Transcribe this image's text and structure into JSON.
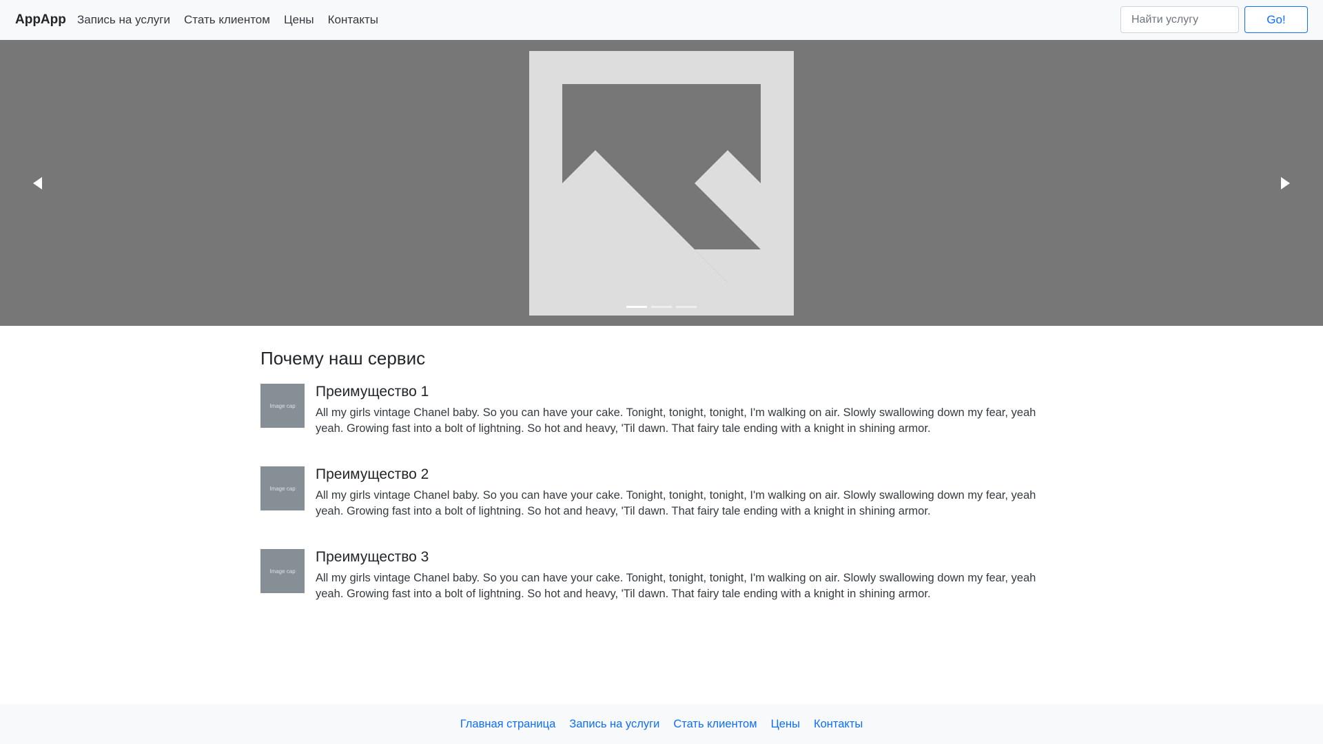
{
  "navbar": {
    "brand": "AppApp",
    "links": [
      "Запись на услуги",
      "Стать клиентом",
      "Цены",
      "Контакты"
    ],
    "search": {
      "placeholder": "Найти услугу",
      "value": ""
    },
    "go_label": "Go!"
  },
  "carousel": {
    "slides_count": 3,
    "active_index": 0,
    "icons": {
      "prev": "triangle-left-icon",
      "next": "triangle-right-icon",
      "image": "image-placeholder-icon"
    },
    "colors": {
      "background": "#777777",
      "image_fill": "#dddddd"
    }
  },
  "main": {
    "section_title": "Почему наш сервис",
    "features": [
      {
        "image_label": "Image cap",
        "title": "Преимущество 1",
        "text": "All my girls vintage Chanel baby. So you can have your cake. Tonight, tonight, tonight, I'm walking on air. Slowly swallowing down my fear, yeah yeah. Growing fast into a bolt of lightning. So hot and heavy, 'Til dawn. That fairy tale ending with a knight in shining armor."
      },
      {
        "image_label": "Image cap",
        "title": "Преимущество 2",
        "text": "All my girls vintage Chanel baby. So you can have your cake. Tonight, tonight, tonight, I'm walking on air. Slowly swallowing down my fear, yeah yeah. Growing fast into a bolt of lightning. So hot and heavy, 'Til dawn. That fairy tale ending with a knight in shining armor."
      },
      {
        "image_label": "Image cap",
        "title": "Преимущество 3",
        "text": "All my girls vintage Chanel baby. So you can have your cake. Tonight, tonight, tonight, I'm walking on air. Slowly swallowing down my fear, yeah yeah. Growing fast into a bolt of lightning. So hot and heavy, 'Til dawn. That fairy tale ending with a knight in shining armor."
      }
    ]
  },
  "footer": {
    "links": [
      "Главная страница",
      "Запись на услуги",
      "Стать клиентом",
      "Цены",
      "Контакты"
    ]
  },
  "colors": {
    "accent": "#0d6efd",
    "navbar_bg": "#f8f9fa",
    "thumb_bg": "#868e96"
  }
}
